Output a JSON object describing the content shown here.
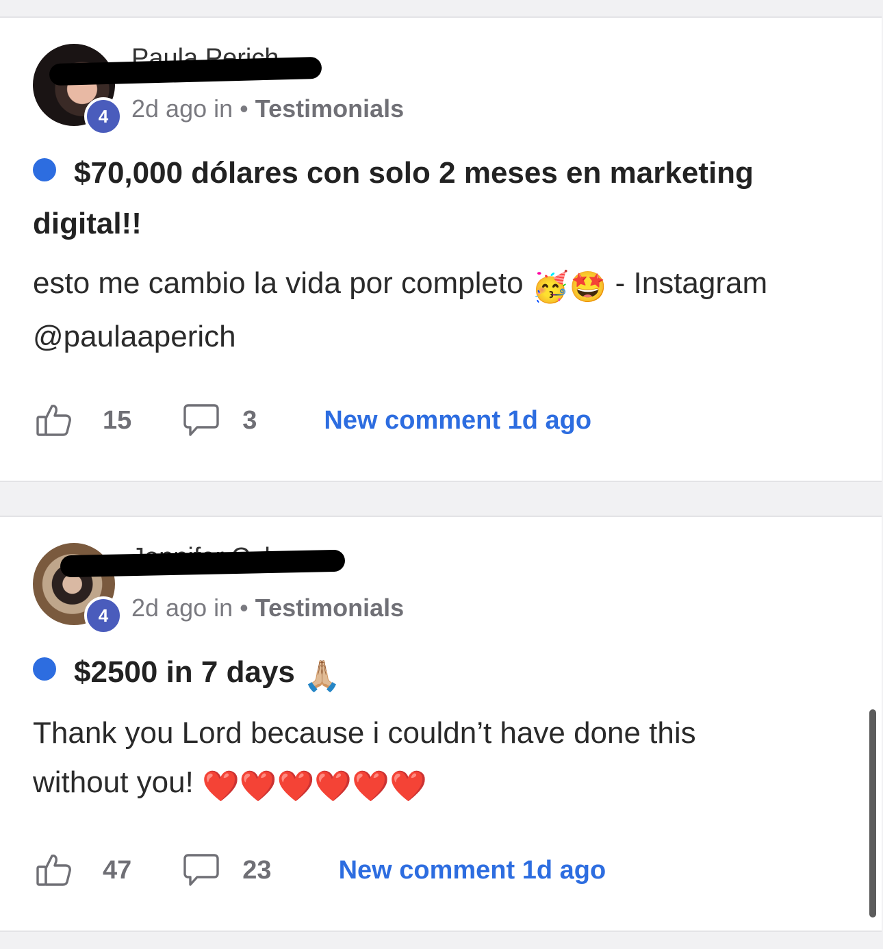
{
  "posts": [
    {
      "author": "Paula Perich",
      "level": "4",
      "meta_prefix": "2d ago in • ",
      "category": "Testimonials",
      "title": "$70,000 dólares con solo 2 meses en marketing digital!!",
      "body_line1": "esto me cambio la vida por completo",
      "body_emoji": "🥳🤩",
      "body_line1_suffix": " - Instagram",
      "body_line2": "@paulaaperich",
      "likes": "15",
      "comments": "3",
      "new_comment": "New comment 1d ago"
    },
    {
      "author": "Jennifer Colon",
      "level": "4",
      "meta_prefix": "2d ago in • ",
      "category": "Testimonials",
      "title": "$2500 in 7 days",
      "title_emoji": "🙏🏼",
      "body_line1": "Thank you Lord because i couldn’t have done this",
      "body_line2": "without you!",
      "body_emoji": "❤️❤️❤️❤️❤️❤️",
      "likes": "47",
      "comments": "23",
      "new_comment": "New comment 1d ago"
    }
  ],
  "colors": {
    "accent": "#2d6de0",
    "badge": "#4a5cbc",
    "muted_text": "#7a7a80",
    "background": "#f1f1f3"
  },
  "icons": [
    "thumbs-up-icon",
    "comment-bubble-icon"
  ]
}
